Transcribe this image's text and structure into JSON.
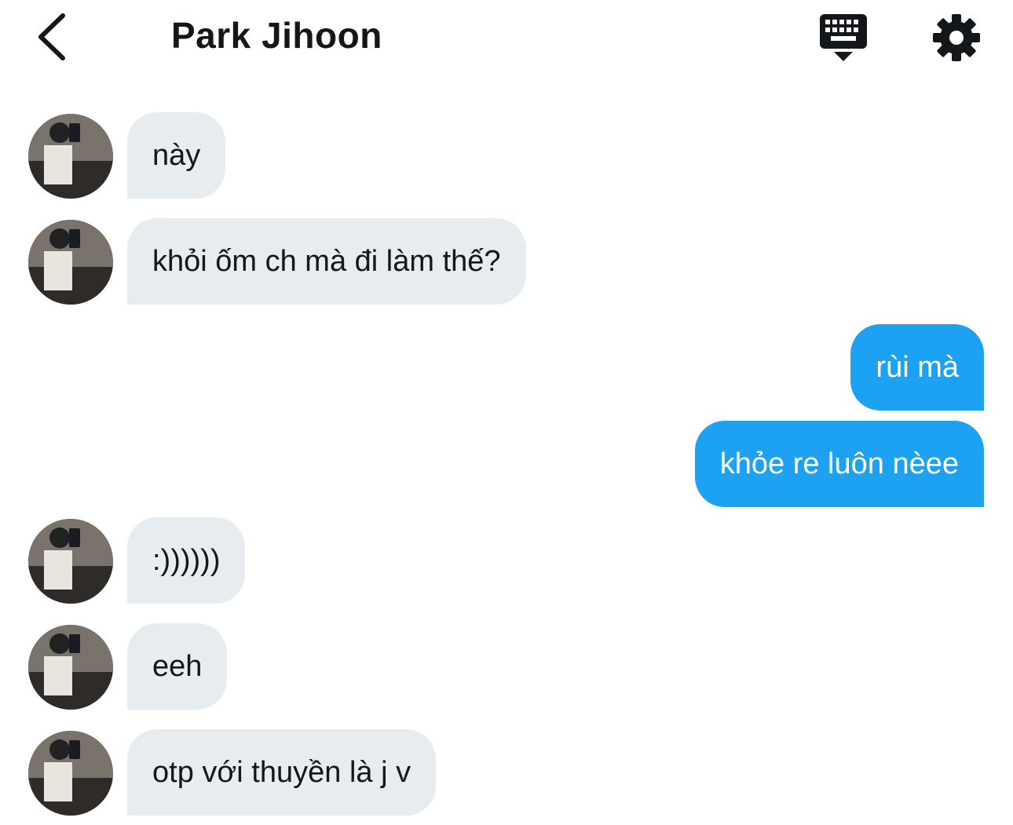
{
  "header": {
    "title": "Park Jihoon",
    "back_icon": "chevron-left-icon",
    "keyboard_icon": "keyboard-hide-icon",
    "settings_icon": "gear-icon"
  },
  "colors": {
    "incoming_bubble": "#e6ecf0",
    "outgoing_bubble": "#1da1f2",
    "text": "#14171a"
  },
  "messages": [
    {
      "direction": "incoming",
      "text": "này"
    },
    {
      "direction": "incoming",
      "text": "khỏi ốm ch mà đi làm thế?"
    },
    {
      "direction": "outgoing",
      "text": "rùi mà"
    },
    {
      "direction": "outgoing",
      "text": "khỏe re luôn nèee"
    },
    {
      "direction": "incoming",
      "text": ":))))))"
    },
    {
      "direction": "incoming",
      "text": "eeh"
    },
    {
      "direction": "incoming",
      "text": "otp với thuyền là j v"
    }
  ]
}
